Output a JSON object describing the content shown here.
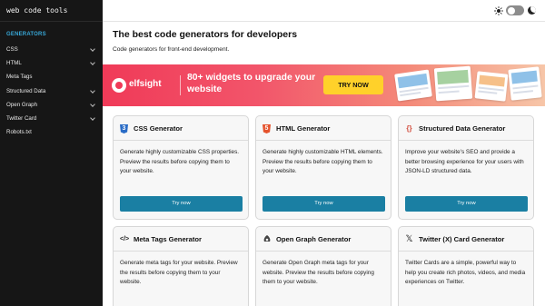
{
  "brand": "web code tools",
  "sidebar": {
    "heading": "GENERATORS",
    "items": [
      {
        "label": "CSS"
      },
      {
        "label": "HTML"
      },
      {
        "label": "Meta Tags"
      },
      {
        "label": "Structured Data"
      },
      {
        "label": "Open Graph"
      },
      {
        "label": "Twitter Card"
      },
      {
        "label": "Robots.txt"
      }
    ]
  },
  "header": {
    "theme_icons": [
      "sun-icon",
      "toggle",
      "moon-icon"
    ]
  },
  "main": {
    "title": "The best code generators for developers",
    "subtitle": "Code generators for front-end development."
  },
  "banner": {
    "brand": "elfsight",
    "headline": "80+ widgets to upgrade your website",
    "cta": "TRY NOW",
    "accent": "#f03a58",
    "cta_color": "#ffd12a"
  },
  "cards": [
    {
      "title": "CSS Generator",
      "icon": "css3-icon",
      "desc": "Generate highly customizable CSS properties. Preview the results before copying them to your website.",
      "button": "Try now"
    },
    {
      "title": "HTML Generator",
      "icon": "html5-icon",
      "desc": "Generate highly customizable HTML elements. Preview the results before copying them to your website.",
      "button": "Try now"
    },
    {
      "title": "Structured Data Generator",
      "icon": "curly-braces-icon",
      "desc": "Improve your website's SEO and provide a better browsing experience for your users with JSON-LD structured data.",
      "button": "Try now"
    },
    {
      "title": "Meta Tags Generator",
      "icon": "code-tag-icon",
      "desc": "Generate meta tags for your website. Preview the results before copying them to your website."
    },
    {
      "title": "Open Graph Generator",
      "icon": "open-graph-icon",
      "desc": "Generate Open Graph meta tags for your website. Preview the results before copying them to your website."
    },
    {
      "title": "Twitter (X) Card Generator",
      "icon": "x-logo-icon",
      "desc": "Twitter Cards are a simple, powerful way to help you create rich photos, videos, and media experiences on Twitter."
    }
  ],
  "colors": {
    "sidebar_bg": "#161616",
    "nav_heading": "#38a8d8",
    "button": "#1a7fa3"
  }
}
